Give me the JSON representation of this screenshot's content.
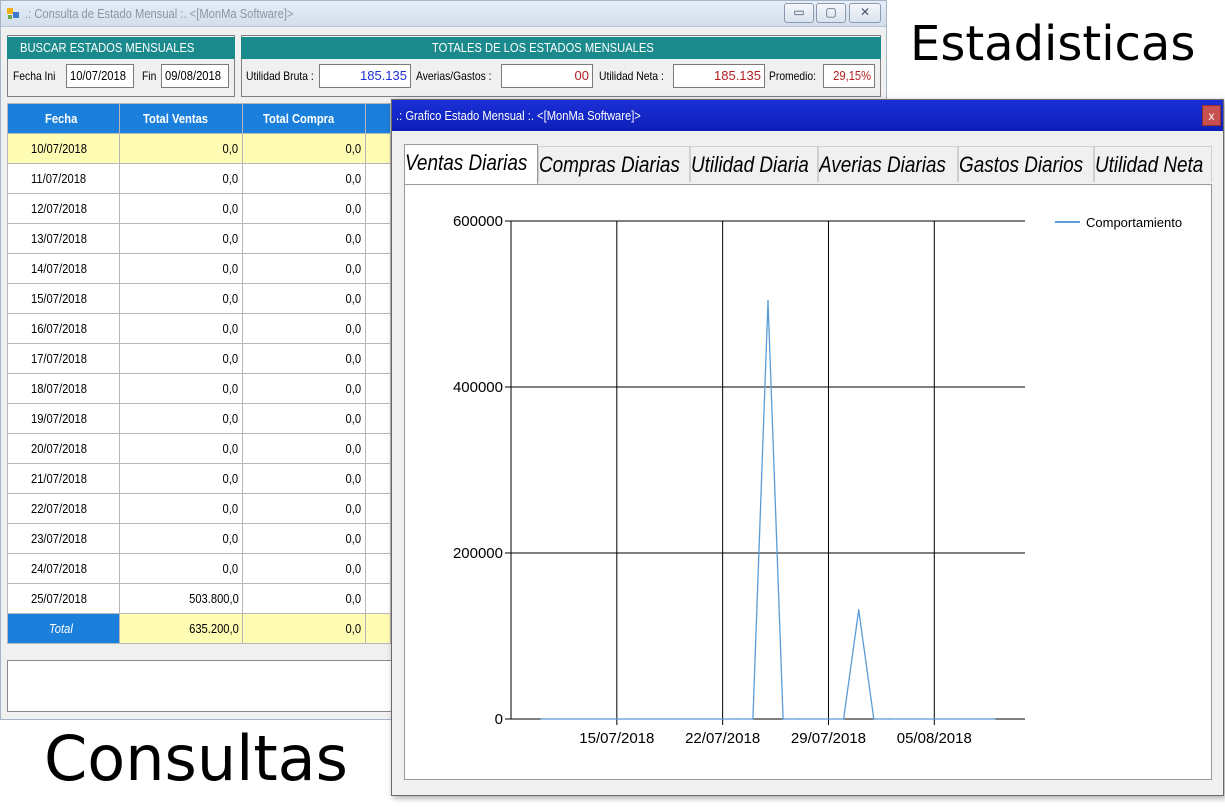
{
  "main_window": {
    "title": ".: Consulta de Estado Mensual :. <[MonMa Software]>",
    "buttons": {
      "minimize": "▭",
      "maximize": "▢",
      "close": "✕"
    }
  },
  "search": {
    "title": "BUSCAR ESTADOS MENSUALES",
    "start_label": "Fecha Ini",
    "start_value": "10/07/2018",
    "end_label": "Fin",
    "end_value": "09/08/2018"
  },
  "totals": {
    "title": "TOTALES DE LOS ESTADOS MENSUALES",
    "gross_label": "Utilidad Bruta :",
    "gross_value": "185.135",
    "losses_label": "Averias/Gastos :",
    "losses_value": "00",
    "net_label": "Utilidad Neta :",
    "net_value": "185.135",
    "avg_label": "Promedio:",
    "avg_value": "29,15%"
  },
  "colors": {
    "value_blue": "#1a2fd6",
    "value_red": "#b32020",
    "header_teal": "#1b8a8c",
    "grid_header": "#1b7fdc",
    "selected_row": "#fffcb4",
    "series_line": "#5b9bd5"
  },
  "table": {
    "columns": [
      "Fecha",
      "Total Ventas",
      "Total Compra"
    ],
    "rows": [
      [
        "10/07/2018",
        "0,0",
        "0,0"
      ],
      [
        "11/07/2018",
        "0,0",
        "0,0"
      ],
      [
        "12/07/2018",
        "0,0",
        "0,0"
      ],
      [
        "13/07/2018",
        "0,0",
        "0,0"
      ],
      [
        "14/07/2018",
        "0,0",
        "0,0"
      ],
      [
        "15/07/2018",
        "0,0",
        "0,0"
      ],
      [
        "16/07/2018",
        "0,0",
        "0,0"
      ],
      [
        "17/07/2018",
        "0,0",
        "0,0"
      ],
      [
        "18/07/2018",
        "0,0",
        "0,0"
      ],
      [
        "19/07/2018",
        "0,0",
        "0,0"
      ],
      [
        "20/07/2018",
        "0,0",
        "0,0"
      ],
      [
        "21/07/2018",
        "0,0",
        "0,0"
      ],
      [
        "22/07/2018",
        "0,0",
        "0,0"
      ],
      [
        "23/07/2018",
        "0,0",
        "0,0"
      ],
      [
        "24/07/2018",
        "0,0",
        "0,0"
      ],
      [
        "25/07/2018",
        "503.800,0",
        "0,0"
      ]
    ],
    "total_label": "Total",
    "total_sales": "635.200,0",
    "total_purchases": "0,0"
  },
  "labels": {
    "estadisticas": "Estadisticas",
    "consultas": "Consultas"
  },
  "chart_window": {
    "title": ".: Grafico Estado Mensual :. <[MonMa Software]>",
    "close": "x",
    "tabs": [
      "Ventas Diarias",
      "Compras Diarias",
      "Utilidad Diaria",
      "Averias Diarias",
      "Gastos Diarios",
      "Utilidad Neta"
    ],
    "active_tab": 0
  },
  "chart_data": {
    "type": "line",
    "x_tick_labels": [
      "15/07/2018",
      "22/07/2018",
      "29/07/2018",
      "05/08/2018"
    ],
    "y_tick_labels": [
      "0",
      "200000",
      "400000",
      "600000"
    ],
    "ylim": [
      0,
      600000
    ],
    "xlim": [
      "2018-07-08",
      "2018-08-11"
    ],
    "grid": true,
    "legend": "top-right",
    "series": [
      {
        "name": "Comportamiento",
        "x": [
          "2018-07-10",
          "2018-07-23",
          "2018-07-24",
          "2018-07-25",
          "2018-07-26",
          "2018-07-27",
          "2018-07-30",
          "2018-07-31",
          "2018-08-01",
          "2018-08-02",
          "2018-08-09"
        ],
        "y": [
          0,
          0,
          0,
          503800,
          0,
          0,
          0,
          131400,
          0,
          0,
          0
        ]
      }
    ]
  }
}
